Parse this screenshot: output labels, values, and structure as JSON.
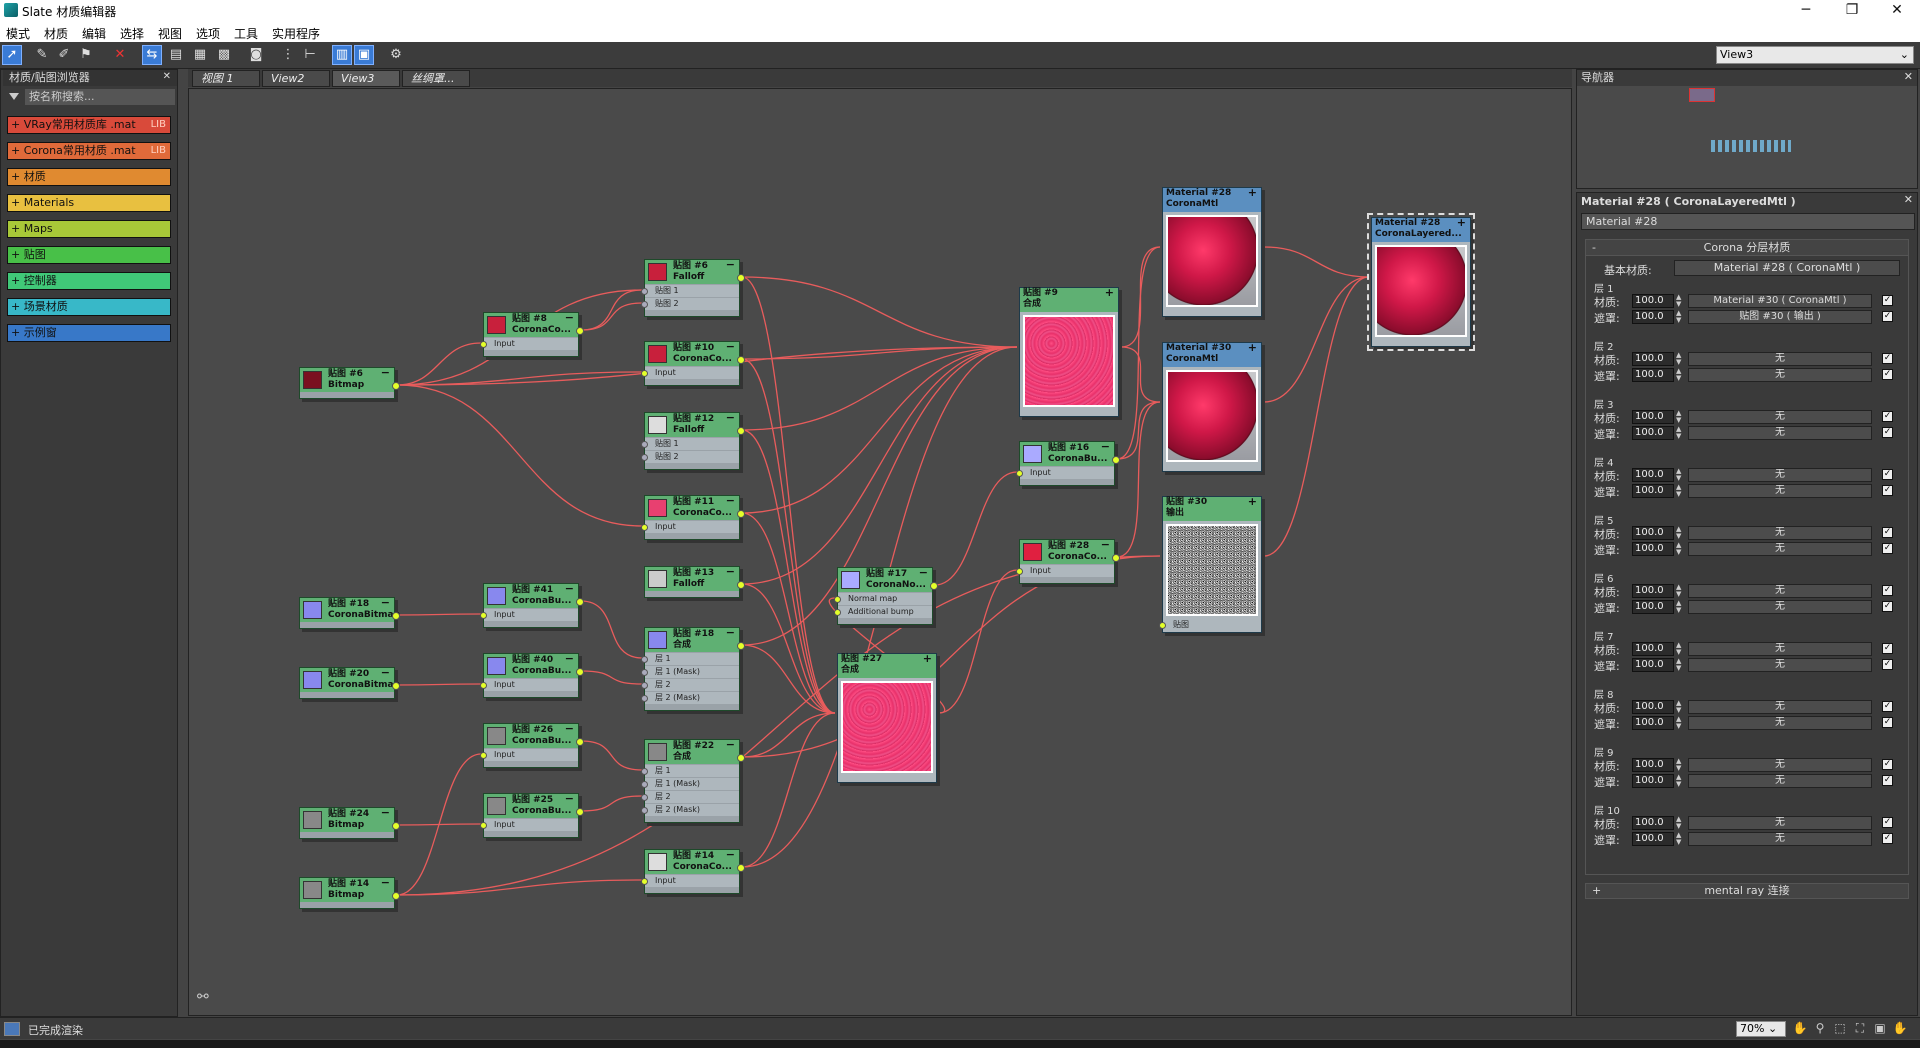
{
  "window": {
    "title": "Slate 材质编辑器",
    "minimize": "─",
    "maximize": "❐",
    "close": "✕"
  },
  "menu": [
    "模式",
    "材质",
    "编辑",
    "选择",
    "视图",
    "选项",
    "工具",
    "实用程序"
  ],
  "toolbar": {
    "view_select": "View3"
  },
  "browser": {
    "title": "材质/贴图浏览器",
    "search_placeholder": "按名称搜索...",
    "libraries": [
      {
        "label": "+ VRay常用材质库 .mat",
        "tag": "LIB",
        "color": "#d94a3a"
      },
      {
        "label": "+ Corona常用材质 .mat",
        "tag": "LIB",
        "color": "#e06a3a"
      },
      {
        "label": "+ 材质",
        "tag": "",
        "color": "#e08a30"
      },
      {
        "label": "+ Materials",
        "tag": "",
        "color": "#e8c040"
      },
      {
        "label": "+ Maps",
        "tag": "",
        "color": "#a8c838"
      },
      {
        "label": "+ 贴图",
        "tag": "",
        "color": "#48c048"
      },
      {
        "label": "+ 控制器",
        "tag": "",
        "color": "#40c878"
      },
      {
        "label": "+ 场景材质",
        "tag": "",
        "color": "#38b8c8"
      },
      {
        "label": "+ 示例窗",
        "tag": "",
        "color": "#3878c8"
      }
    ]
  },
  "tabs": [
    "视图 1",
    "View2",
    "View3",
    "丝绸罩..."
  ],
  "nodes": [
    {
      "id": "n1",
      "line1": "贴图 #6",
      "line2": "Bitmap",
      "slots": [],
      "swatch": "#7a1020"
    },
    {
      "id": "n2",
      "line1": "贴图 #8",
      "line2": "CoronaCo...",
      "slots": [
        "Input"
      ],
      "swatch": "#c8203c"
    },
    {
      "id": "n3",
      "line1": "贴图 #6",
      "line2": "Falloff",
      "slots": [
        "贴图 1",
        "贴图 2"
      ],
      "swatch": "#c8203c"
    },
    {
      "id": "n4",
      "line1": "贴图 #10",
      "line2": "CoronaCo...",
      "slots": [
        "Input"
      ],
      "swatch": "#c8203c"
    },
    {
      "id": "n5",
      "line1": "贴图 #12",
      "line2": "Falloff",
      "slots": [
        "贴图 1",
        "贴图 2"
      ],
      "swatch": "#dddddd"
    },
    {
      "id": "n6",
      "line1": "贴图 #11",
      "line2": "CoronaCo...",
      "slots": [
        "Input"
      ],
      "swatch": "#e84070"
    },
    {
      "id": "n7",
      "line1": "贴图 #13",
      "line2": "Falloff",
      "slots": [],
      "swatch": "#cccccc"
    },
    {
      "id": "n8",
      "line1": "贴图 #18",
      "line2": "CoronaBitmap",
      "slots": [],
      "swatch": "#8888ee"
    },
    {
      "id": "n9",
      "line1": "贴图 #41",
      "line2": "CoronaBu...",
      "slots": [
        "Input"
      ],
      "swatch": "#8888ee"
    },
    {
      "id": "n10",
      "line1": "贴图 #18",
      "line2": "合成",
      "slots": [
        "层 1",
        "层 1 (Mask)",
        "层 2",
        "层 2 (Mask)"
      ],
      "swatch": "#8888ee"
    },
    {
      "id": "n11",
      "line1": "贴图 #20",
      "line2": "CoronaBitmap",
      "slots": [],
      "swatch": "#8888ee"
    },
    {
      "id": "n12",
      "line1": "贴图 #40",
      "line2": "CoronaBu...",
      "slots": [
        "Input"
      ],
      "swatch": "#8888ee"
    },
    {
      "id": "n13",
      "line1": "贴图 #26",
      "line2": "CoronaBu...",
      "slots": [
        "Input"
      ],
      "swatch": "#888888"
    },
    {
      "id": "n14",
      "line1": "贴图 #22",
      "line2": "合成",
      "slots": [
        "层 1",
        "层 1 (Mask)",
        "层 2",
        "层 2 (Mask)"
      ],
      "swatch": "#888888"
    },
    {
      "id": "n15",
      "line1": "贴图 #24",
      "line2": "Bitmap",
      "slots": [],
      "swatch": "#888888"
    },
    {
      "id": "n16",
      "line1": "贴图 #25",
      "line2": "CoronaBu...",
      "slots": [
        "Input"
      ],
      "swatch": "#888888"
    },
    {
      "id": "n17",
      "line1": "贴图 #14",
      "line2": "Bitmap",
      "slots": [],
      "swatch": "#888888"
    },
    {
      "id": "n18",
      "line1": "贴图 #14",
      "line2": "CoronaCo...",
      "slots": [
        "Input"
      ],
      "swatch": "#dddddd"
    },
    {
      "id": "n19",
      "line1": "贴图 #17",
      "line2": "CoronaNo...",
      "slots": [
        "Normal map",
        "Additional bump"
      ],
      "swatch": "#aaaaff"
    },
    {
      "id": "n20",
      "line1": "贴图 #16",
      "line2": "CoronaBu...",
      "slots": [
        "Input"
      ],
      "swatch": "#aaaaff"
    },
    {
      "id": "n21",
      "line1": "贴图 #28",
      "line2": "CoronaCo...",
      "slots": [
        "Input"
      ],
      "swatch": "#e02040"
    }
  ],
  "big_nodes": [
    {
      "id": "b1",
      "line1": "贴图 #9",
      "line2": "合成",
      "kind": "pink",
      "slot": ""
    },
    {
      "id": "b2",
      "line1": "贴图 #27",
      "line2": "合成",
      "kind": "pink",
      "slot": ""
    },
    {
      "id": "b3",
      "line1": "Material #28",
      "line2": "CoronaMtl",
      "kind": "sphere",
      "slot": ""
    },
    {
      "id": "b4",
      "line1": "Material #30",
      "line2": "CoronaMtl",
      "kind": "sphere",
      "slot": ""
    },
    {
      "id": "b5",
      "line1": "贴图 #30",
      "line2": "输出",
      "kind": "noise",
      "slot": "贴图"
    },
    {
      "id": "b6",
      "line1": "Material #28",
      "line2": "CoronaLayered...",
      "kind": "sphere",
      "slot": ""
    }
  ],
  "navigator": {
    "title": "导航器"
  },
  "props": {
    "title": "Material #28  ( CoronaLayeredMtl )",
    "name": "Material #28",
    "rollout": "Corona 分层材质",
    "base_label": "基本材质:",
    "base_value": "Material #28  ( CoronaMtl )",
    "mat_label": "材质:",
    "mask_label": "遮罩:",
    "layers": [
      {
        "name": "层 1",
        "amount": "100.0",
        "mask_amount": "100.0",
        "mat": "Material #30  ( CoronaMtl )",
        "mask": "贴图 #30  ( 输出 )"
      },
      {
        "name": "层 2",
        "amount": "100.0",
        "mask_amount": "100.0",
        "mat": "无",
        "mask": "无"
      },
      {
        "name": "层 3",
        "amount": "100.0",
        "mask_amount": "100.0",
        "mat": "无",
        "mask": "无"
      },
      {
        "name": "层 4",
        "amount": "100.0",
        "mask_amount": "100.0",
        "mat": "无",
        "mask": "无"
      },
      {
        "name": "层 5",
        "amount": "100.0",
        "mask_amount": "100.0",
        "mat": "无",
        "mask": "无"
      },
      {
        "name": "层 6",
        "amount": "100.0",
        "mask_amount": "100.0",
        "mat": "无",
        "mask": "无"
      },
      {
        "name": "层 7",
        "amount": "100.0",
        "mask_amount": "100.0",
        "mat": "无",
        "mask": "无"
      },
      {
        "name": "层 8",
        "amount": "100.0",
        "mask_amount": "100.0",
        "mat": "无",
        "mask": "无"
      },
      {
        "name": "层 9",
        "amount": "100.0",
        "mask_amount": "100.0",
        "mat": "无",
        "mask": "无"
      },
      {
        "name": "层 10",
        "amount": "100.0",
        "mask_amount": "100.0",
        "mat": "无",
        "mask": "无"
      }
    ],
    "mentalray": "mental ray 连接"
  },
  "status": {
    "text": "已完成渲染",
    "zoom": "70%"
  }
}
